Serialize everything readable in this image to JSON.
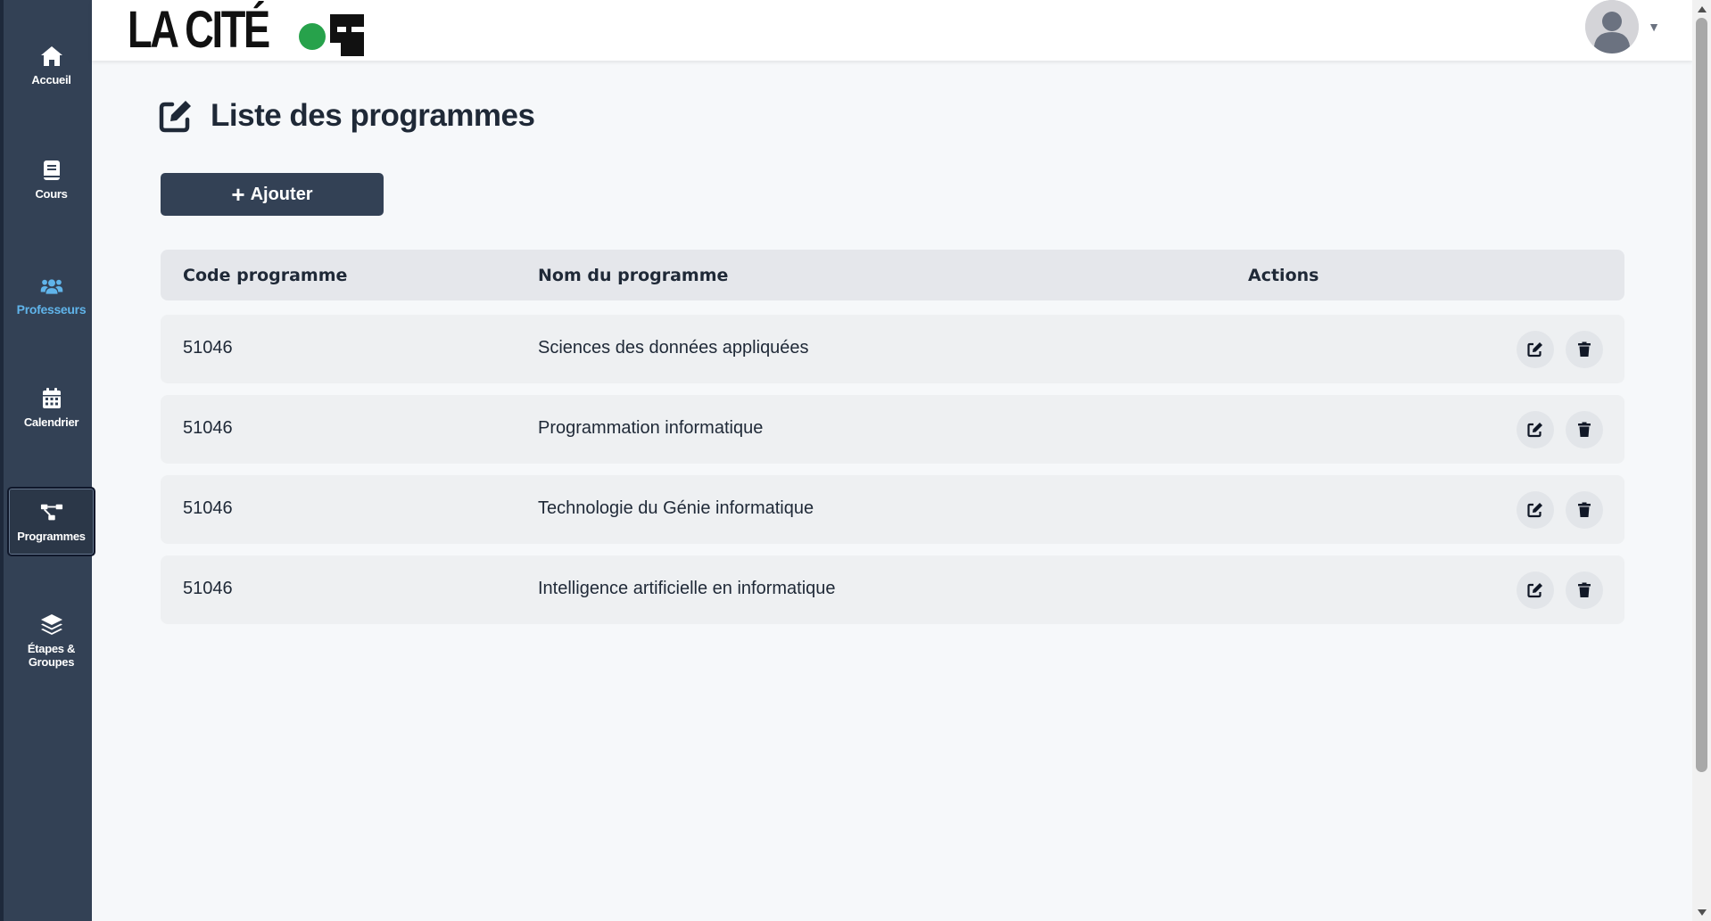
{
  "header": {
    "logo_text": "LA CITÉ",
    "brand_colors": {
      "dot": "#27a24b",
      "text": "#111111"
    }
  },
  "sidebar": {
    "items": [
      {
        "label": "Accueil",
        "icon": "home-icon"
      },
      {
        "label": "Cours",
        "icon": "book-icon"
      },
      {
        "label": "Professeurs",
        "icon": "users-icon",
        "highlight_color": "#60b4ea"
      },
      {
        "label": "Calendrier",
        "icon": "calendar-icon"
      },
      {
        "label": "Programmes",
        "icon": "sitemap-icon",
        "selected": true
      },
      {
        "label": "Étapes & Groupes",
        "icon": "layers-icon"
      }
    ]
  },
  "main": {
    "title": "Liste des programmes",
    "title_icon": "edit-square-icon",
    "add_button": {
      "label": "Ajouter",
      "icon": "plus-icon"
    },
    "table": {
      "columns": [
        "Code programme",
        "Nom du programme",
        "Actions"
      ],
      "rows": [
        {
          "code": "51046",
          "name": "Sciences des données appliquées"
        },
        {
          "code": "51046",
          "name": "Programmation informatique"
        },
        {
          "code": "51046",
          "name": "Technologie du Génie informatique"
        },
        {
          "code": "51046",
          "name": "Intelligence artificielle en informatique"
        }
      ],
      "row_actions": [
        "edit-icon",
        "trash-icon"
      ]
    }
  },
  "colors": {
    "sidebar_bg": "#334155",
    "primary_button": "#334155",
    "page_bg": "#f6f8fa"
  }
}
